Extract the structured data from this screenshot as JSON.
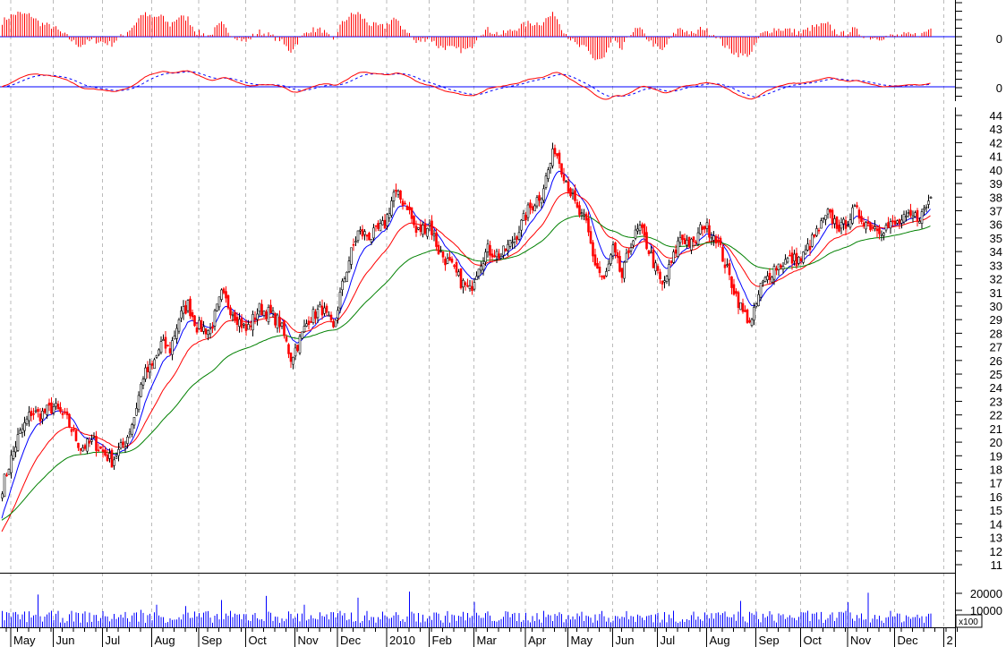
{
  "chart_data": {
    "type": "candlestick",
    "title": "",
    "colors": {
      "up": "#000000",
      "down": "#ff0000",
      "ma_fast": "#0000ff",
      "ma_mid": "#ff0000",
      "ma_slow": "#008000",
      "volume": "#0000ff",
      "grid": "#bbbbbb",
      "zero": "#0000ff"
    },
    "price_axis": {
      "min": 11,
      "max": 44,
      "ticks": [
        11,
        12,
        13,
        14,
        15,
        16,
        17,
        18,
        19,
        20,
        21,
        22,
        23,
        24,
        25,
        26,
        27,
        28,
        29,
        30,
        31,
        32,
        33,
        34,
        35,
        36,
        37,
        38,
        39,
        40,
        41,
        42,
        43,
        44
      ]
    },
    "volume_axis": {
      "ticks": [
        10000,
        20000
      ],
      "unit_label": "x100"
    },
    "oscillator_labels": [
      "0",
      "0"
    ],
    "price_series": {
      "days": [
        0,
        3,
        7,
        13,
        17,
        23,
        29,
        35,
        41,
        49,
        55,
        59,
        63,
        67,
        71,
        75,
        79,
        83,
        87,
        93,
        98,
        103,
        109,
        115,
        119,
        124,
        129,
        133,
        137,
        143,
        148,
        151,
        155,
        159,
        165,
        171,
        175,
        181,
        185,
        191,
        195,
        201,
        205,
        209,
        213,
        217,
        223,
        229,
        235,
        241,
        247,
        251,
        257,
        261,
        265,
        269,
        273,
        277,
        281,
        285,
        289,
        295,
        299,
        303,
        309,
        313,
        319,
        325,
        331,
        335,
        339,
        345,
        351,
        357,
        363,
        369,
        375,
        381,
        387,
        393,
        399,
        405,
        411,
        415
      ],
      "closes": [
        16.7,
        18.3,
        20.3,
        22.2,
        22,
        22.6,
        21.6,
        19.6,
        20,
        18.6,
        20,
        21.9,
        24.9,
        25.5,
        27.2,
        26.8,
        29.1,
        30.1,
        28.5,
        28.2,
        30.8,
        29.6,
        28.2,
        29.8,
        29.5,
        28.8,
        26.2,
        27.5,
        29.1,
        29.8,
        28.2,
        30.8,
        33.4,
        35.4,
        35.1,
        36,
        38.3,
        37.4,
        35.4,
        36,
        34.1,
        32.8,
        31.8,
        31.1,
        33.1,
        34.1,
        33.7,
        35,
        37,
        38.3,
        41.6,
        39.7,
        37,
        36,
        33.1,
        31.8,
        34.1,
        32.1,
        34.7,
        35.7,
        34.1,
        31.4,
        33.1,
        35.1,
        34.4,
        36,
        35.1,
        32.1,
        29.5,
        28.8,
        31.4,
        32.8,
        33.4,
        33.4,
        35.1,
        36.7,
        35.7,
        37,
        36,
        35.7,
        36,
        36.4,
        36.7,
        38
      ]
    },
    "moving_averages": [
      {
        "name": "fast",
        "period": 10,
        "start": 14.0
      },
      {
        "name": "mid",
        "period": 25,
        "start": 13.2
      },
      {
        "name": "slow",
        "period": 60,
        "start": 14.2
      }
    ],
    "volume_typical_x100": 6500,
    "x_axis": {
      "month_start_days": [
        4,
        23,
        45,
        67,
        88,
        109,
        131,
        150,
        172,
        191,
        211,
        234,
        253,
        273,
        293,
        315,
        337,
        357,
        378,
        399,
        421
      ],
      "labels": [
        "May",
        "Jun",
        "Jul",
        "Aug",
        "Sep",
        "Oct",
        "Nov",
        "Dec",
        "2010",
        "Feb",
        "Mar",
        "Apr",
        "May",
        "Jun",
        "Jul",
        "Aug",
        "Sep",
        "Oct",
        "Nov",
        "Dec",
        "2"
      ]
    }
  }
}
